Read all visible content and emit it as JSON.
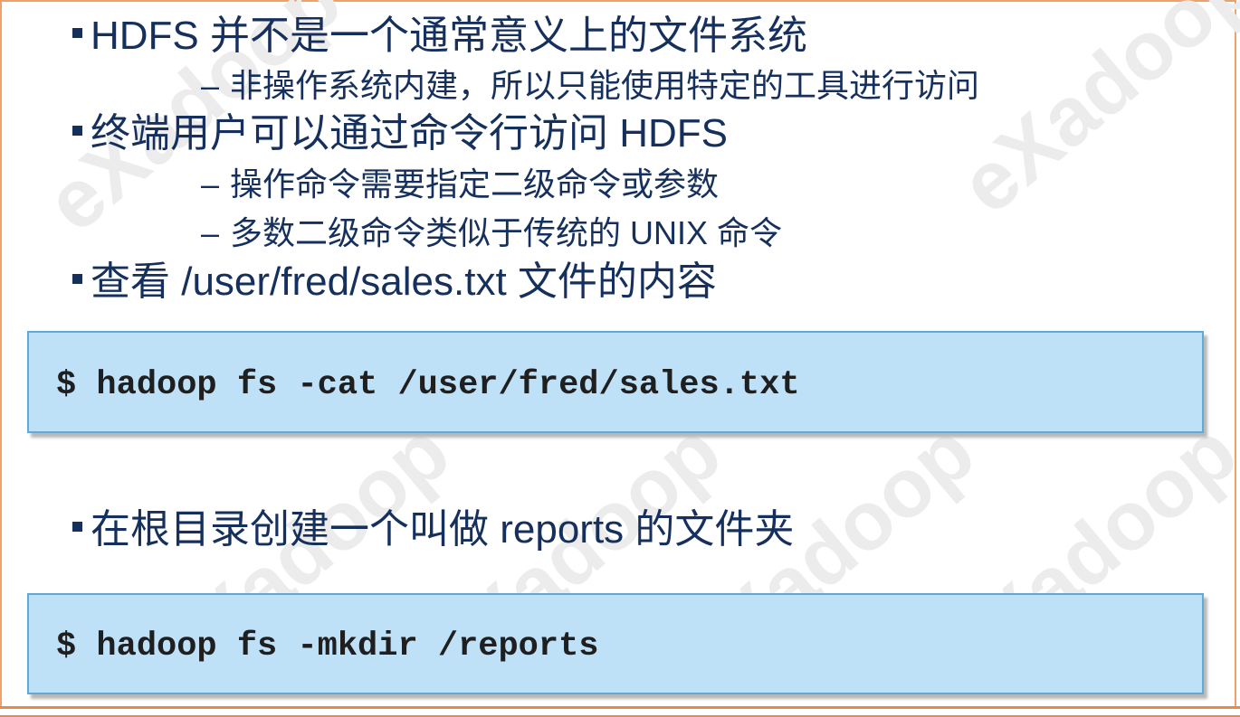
{
  "slide": {
    "bullets": [
      {
        "text": "HDFS 并不是一个通常意义上的文件系统"
      },
      {
        "text": "终端用户可以通过命令行访问 HDFS"
      },
      {
        "text": "查看 /user/fred/sales.txt 文件的内容"
      },
      {
        "text": "在根目录创建一个叫做 reports 的文件夹"
      }
    ],
    "sub_bullets": [
      {
        "text": "非操作系统内建，所以只能使用特定的工具进行访问"
      },
      {
        "text": "操作命令需要指定二级命令或参数"
      },
      {
        "text": "多数二级命令类似于传统的 UNIX 命令"
      }
    ],
    "dash": "–",
    "code_blocks": [
      {
        "command": "$ hadoop fs -cat /user/fred/sales.txt"
      },
      {
        "command": "$ hadoop fs -mkdir /reports"
      }
    ],
    "watermark": "eXadoop"
  },
  "colors": {
    "text": "#16305e",
    "code_bg": "#bfe1f8",
    "code_border": "#63a9d8",
    "frame": "#e58a4c"
  }
}
